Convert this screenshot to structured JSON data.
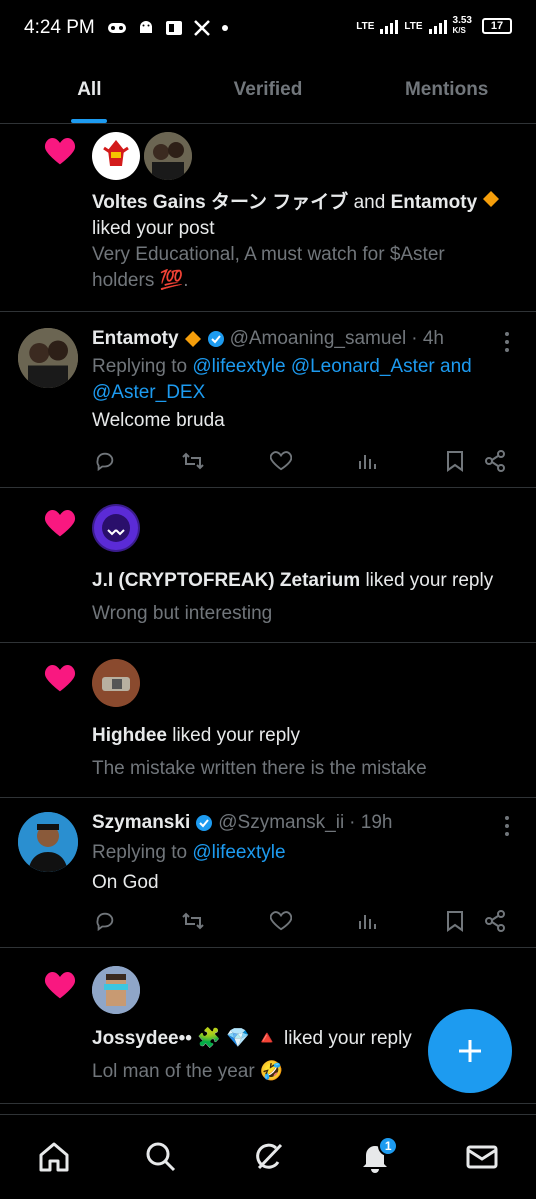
{
  "status_bar": {
    "time": "4:24 PM",
    "network1": "LTE",
    "network2": "LTE",
    "speed": "3.53",
    "speed_unit": "K/S",
    "battery": "17"
  },
  "tabs": [
    {
      "label": "All",
      "active": true
    },
    {
      "label": "Verified",
      "active": false
    },
    {
      "label": "Mentions",
      "active": false
    }
  ],
  "notifications": [
    {
      "type": "like",
      "actors_bold1": "Voltes Gains ターン ファイブ",
      "joiner": "and",
      "actors_bold2": "Entamoty",
      "action": "liked your post",
      "preview": "Very Educational, A must watch for $Aster holders 💯."
    },
    {
      "type": "reply",
      "name": "Entamoty",
      "handle": "@Amoaning_samuel",
      "time": "· 4h",
      "replying_prefix": "Replying to",
      "replying_to": "@lifeextyle @Leonard_Aster and @Aster_DEX",
      "text": "Welcome bruda"
    },
    {
      "type": "like",
      "actor": "J.I (CRYPTOFREAK) Zetarium",
      "action": "liked your reply",
      "preview": "Wrong but interesting"
    },
    {
      "type": "like",
      "actor": "Highdee",
      "action": "liked your reply",
      "preview": "The mistake written there is the mistake"
    },
    {
      "type": "reply",
      "name": "Szymanski",
      "handle": "@Szymansk_ii",
      "time": "· 19h",
      "replying_prefix": "Replying to",
      "replying_to": "@lifeextyle",
      "text": "On God"
    },
    {
      "type": "like",
      "actor": "Jossydee•• 🧩 💎 🔺",
      "action": "liked your reply",
      "preview": "Lol man of the year 🤣"
    }
  ],
  "bottom_nav": {
    "items": [
      "home-icon",
      "search-icon",
      "grok-icon",
      "notifications-icon",
      "messages-icon"
    ],
    "notification_badge": "1"
  },
  "colors": {
    "accent": "#1d9bf0",
    "like": "#f91880",
    "muted": "#71767b",
    "divider": "#2f3336"
  }
}
